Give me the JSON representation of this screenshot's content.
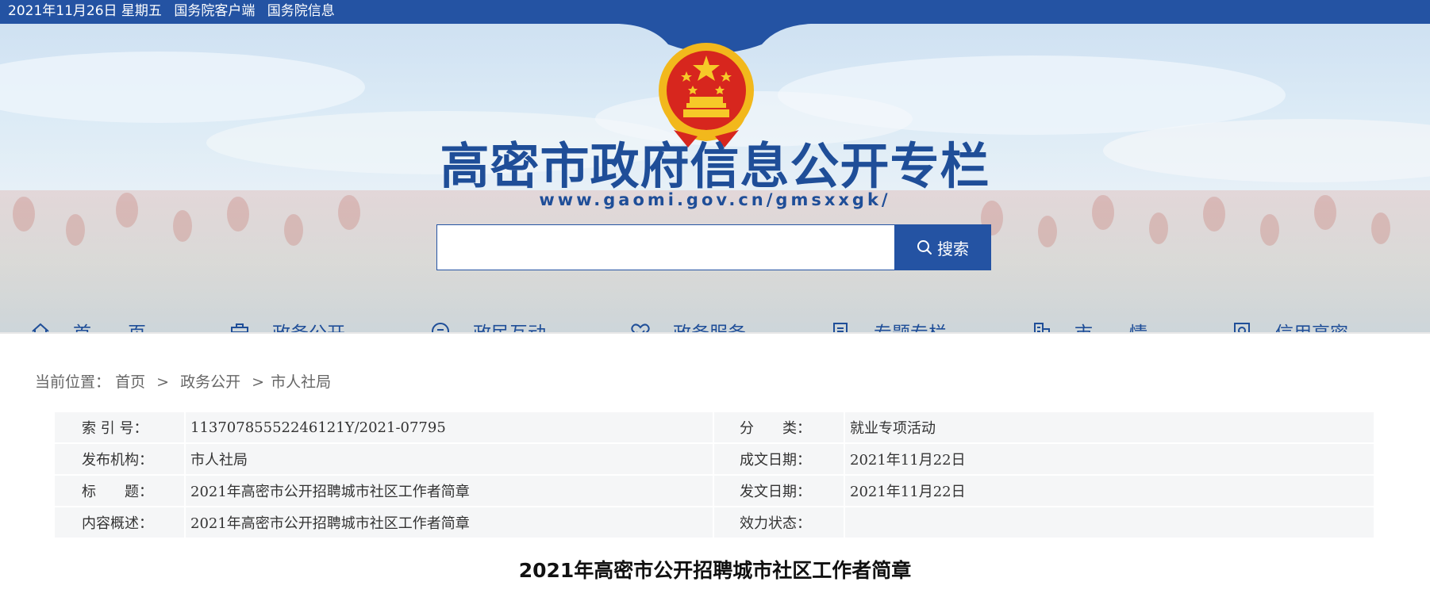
{
  "topbar": {
    "date": "2021年11月26日 星期五",
    "links": [
      "国务院客户端",
      "国务院信息"
    ]
  },
  "header": {
    "title": "高密市政府信息公开专栏",
    "url": "www.gaomi.gov.cn/gmsxxgk/",
    "emblem_icon": "national-emblem-icon"
  },
  "search": {
    "placeholder": "",
    "value": "",
    "button_label": "搜索"
  },
  "nav": {
    "items": [
      {
        "label": "首　　页",
        "icon": "home-icon"
      },
      {
        "label": "政务公开",
        "icon": "briefcase-icon"
      },
      {
        "label": "政民互动",
        "icon": "chat-icon"
      },
      {
        "label": "政务服务",
        "icon": "handshake-icon"
      },
      {
        "label": "专题专栏",
        "icon": "document-icon"
      },
      {
        "label": "市　　情",
        "icon": "building-icon"
      },
      {
        "label": "信用高密",
        "icon": "credit-search-icon"
      }
    ]
  },
  "breadcrumb": {
    "prefix": "当前位置：",
    "items": [
      "首页",
      "政务公开",
      "市人社局"
    ],
    "separators": [
      ">",
      ">"
    ]
  },
  "meta": {
    "rows": [
      {
        "label1": "索 引 号：",
        "value1": "11370785552246121Y/2021-07795",
        "label2": "分　　类：",
        "value2": "就业专项活动"
      },
      {
        "label1": "发布机构：",
        "value1": "市人社局",
        "label2": "成文日期：",
        "value2": "2021年11月22日"
      },
      {
        "label1": "标　　题：",
        "value1": "2021年高密市公开招聘城市社区工作者简章",
        "label2": "发文日期：",
        "value2": "2021年11月22日"
      },
      {
        "label1": "内容概述：",
        "value1": "2021年高密市公开招聘城市社区工作者简章",
        "label2": "效力状态：",
        "value2": ""
      }
    ]
  },
  "article": {
    "title": "2021年高密市公开招聘城市社区工作者简章"
  },
  "colors": {
    "primary": "#2453a3",
    "title_blue": "#1f4e98",
    "emblem_red": "#d7261e",
    "emblem_gold": "#f2b81c"
  }
}
